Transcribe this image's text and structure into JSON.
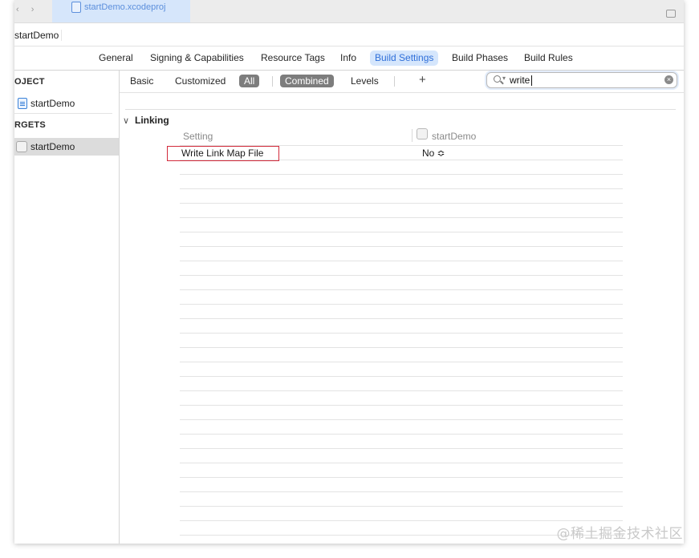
{
  "window": {
    "file_tab": "startDemo.xcodeproj",
    "breadcrumb": "startDemo"
  },
  "editor_tabs": [
    {
      "label": "General",
      "active": false
    },
    {
      "label": "Signing & Capabilities",
      "active": false
    },
    {
      "label": "Resource Tags",
      "active": false
    },
    {
      "label": "Info",
      "active": false
    },
    {
      "label": "Build Settings",
      "active": true
    },
    {
      "label": "Build Phases",
      "active": false
    },
    {
      "label": "Build Rules",
      "active": false
    }
  ],
  "sidebar": {
    "project_heading": "OJECT",
    "project_item": "startDemo",
    "targets_heading": "RGETS",
    "target_item": "startDemo"
  },
  "filter": {
    "basic": "Basic",
    "customized": "Customized",
    "all": "All",
    "combined": "Combined",
    "levels": "Levels",
    "add": "+"
  },
  "search": {
    "value": "write",
    "clear_icon": "clear-circle-icon"
  },
  "settings": {
    "section_title": "Linking",
    "column_setting": "Setting",
    "column_target": "startDemo",
    "rows": [
      {
        "name": "Write Link Map File",
        "value": "No ≎"
      }
    ],
    "empty_row_count": 27
  },
  "colors": {
    "accent": "#2f6fd9",
    "highlight_border": "#d22a3b",
    "selection": "#dcdcdc"
  },
  "watermark": "@稀土掘金技术社区"
}
